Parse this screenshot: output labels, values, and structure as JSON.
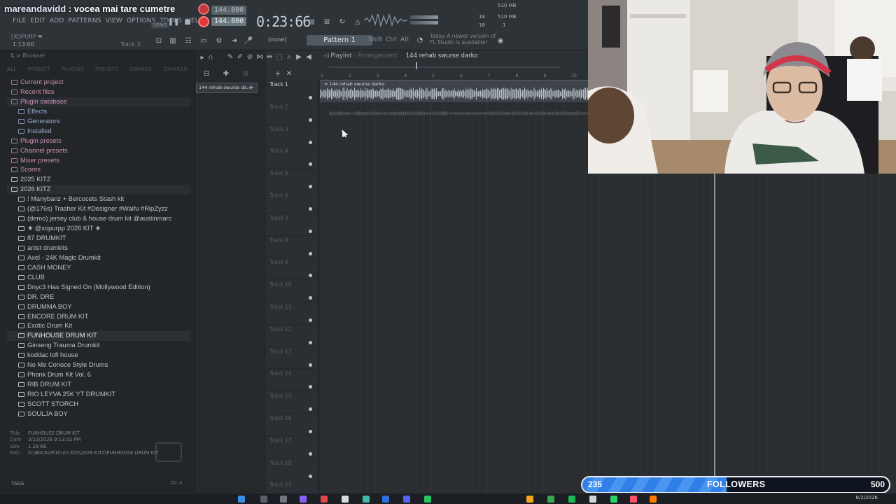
{
  "chat": {
    "user": "mareandavidd",
    "message": "vocea mai tare cumetre"
  },
  "menu": [
    "FILE",
    "EDIT",
    "ADD",
    "PATTERNS",
    "VIEW",
    "OPTIONS",
    "TOOLS",
    "HELP"
  ],
  "transport": {
    "song_label": "SONG",
    "tempo": "144.000",
    "tempo_ghost": "144.000",
    "time": "0:23:66",
    "pattern": "Pattern 1",
    "none": "(none)",
    "current_time": "1:13:00",
    "current_track": "Track 3",
    "plugin_hint": "[XOPURP ❤",
    "snap_keys": [
      "Shift",
      "Ctrl",
      "Alt"
    ],
    "update_line1": "Today  A newer version of",
    "update_line2": "FL Studio is available!",
    "mem_top": "510 MB",
    "mem_bottom": "510 MB",
    "cpu_top": "18",
    "cpu_bottom": "18",
    "voices": "1"
  },
  "browser": {
    "title": "Browser",
    "tabs": [
      "ALL",
      "PROJECT",
      "PLUGINS",
      "PRESETS",
      "SOUNDS",
      "STARRED"
    ],
    "items": [
      {
        "label": "Current project",
        "kind": "top"
      },
      {
        "label": "Recent files",
        "kind": "top"
      },
      {
        "label": "Plugin database",
        "kind": "top-open"
      },
      {
        "label": "Effects",
        "kind": "sub"
      },
      {
        "label": "Generators",
        "kind": "sub"
      },
      {
        "label": "Installed",
        "kind": "sub"
      },
      {
        "label": "Plugin presets",
        "kind": "top"
      },
      {
        "label": "Channel presets",
        "kind": "top"
      },
      {
        "label": "Mixer presets",
        "kind": "top"
      },
      {
        "label": "Scores",
        "kind": "top"
      },
      {
        "label": "2025 KITZ",
        "kind": "folder"
      },
      {
        "label": "2026 KITZ",
        "kind": "folder-open"
      },
      {
        "label": "! Manybanz + Bercocets Stash kit",
        "kind": "kit"
      },
      {
        "label": "(@176s) Trasher Kit #Designer #Waifu #RipZyzz",
        "kind": "kit"
      },
      {
        "label": "(demo) jersey club & house drum kit @austinmarc",
        "kind": "kit"
      },
      {
        "label": "★ @xopurpp 2026 KIT ★",
        "kind": "kit"
      },
      {
        "label": "87 DRUMKIT",
        "kind": "kit"
      },
      {
        "label": "artist drumkits",
        "kind": "kit"
      },
      {
        "label": "Axel - 24K Magic Drumkit",
        "kind": "kit"
      },
      {
        "label": "CASH MONEY",
        "kind": "kit"
      },
      {
        "label": "CLUB",
        "kind": "kit"
      },
      {
        "label": "Dnyc3 Has Signed On (Mollywood Edition)",
        "kind": "kit"
      },
      {
        "label": "DR. DRE",
        "kind": "kit"
      },
      {
        "label": "DRUMMA BOY",
        "kind": "kit"
      },
      {
        "label": "ENCORE DRUM KIT",
        "kind": "kit"
      },
      {
        "label": "Exotic Drum Kit",
        "kind": "kit"
      },
      {
        "label": "FUNHOUSE DRUM KIT",
        "kind": "kit-selected"
      },
      {
        "label": "Ginseng Trauma Drumkit",
        "kind": "kit"
      },
      {
        "label": "koddac lofi house",
        "kind": "kit"
      },
      {
        "label": "No Me Conoce Style Drums",
        "kind": "kit"
      },
      {
        "label": "Phonk Drum Kit Vol. 6",
        "kind": "kit"
      },
      {
        "label": "RIB DRUM KIT",
        "kind": "kit"
      },
      {
        "label": "RIO LEYVA 25K YT DRUMKIT",
        "kind": "kit"
      },
      {
        "label": "SCOTT STORCH",
        "kind": "kit"
      },
      {
        "label": "SOULJA BOY",
        "kind": "kit"
      }
    ],
    "file_info": {
      "title_key": "Title",
      "title": "FUNHOUSE DRUM KIT",
      "date_key": "Date",
      "date": "3/23/2026 9:13:32 PM",
      "size_key": "Size",
      "size": "1.28 KB",
      "path_key": "Path",
      "path": "D:\\BACKUP\\Drum Kits\\2026 KITZ\\FUNHOUSE DRUM KIT"
    },
    "tags_label": "TAGS"
  },
  "pattern_column": {
    "item": "144 rehab swurse da..."
  },
  "playlist": {
    "title": "Playlist",
    "subtitle": "Arrangement",
    "song": "144 rehab swurse darko",
    "clip_label": "144 rehab swurse darko",
    "ruler": [
      "1",
      "2",
      "3",
      "4",
      "5",
      "6",
      "7",
      "8",
      "9",
      "10"
    ],
    "tracks": [
      "Track 1",
      "Track 2",
      "Track 3",
      "Track 4",
      "Track 5",
      "Track 6",
      "Track 7",
      "Track 8",
      "Track 9",
      "Track 10",
      "Track 11",
      "Track 12",
      "Track 13",
      "Track 14",
      "Track 15",
      "Track 16",
      "Track 17",
      "Track 18",
      "Track 19"
    ]
  },
  "followers": {
    "current": "235",
    "label": "FOLLOWERS",
    "goal": "500",
    "progress": 0.47
  },
  "taskbar": {
    "date": "8/2/2026"
  },
  "colors": {
    "accent_blue": "#2f7fe6",
    "record_red": "#e03a3a",
    "preset_pink": "#c88fb4"
  }
}
